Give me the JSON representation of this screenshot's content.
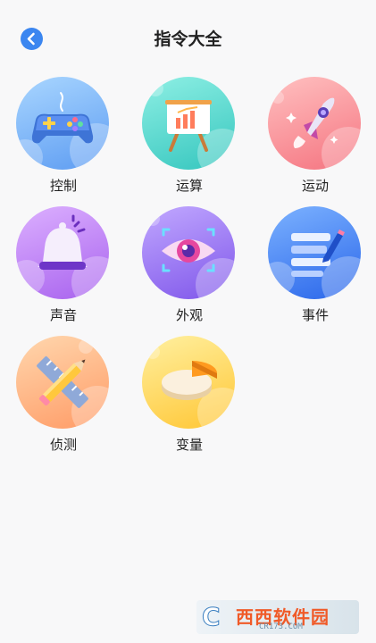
{
  "header": {
    "title": "指令大全"
  },
  "categories": [
    {
      "label": "控制",
      "icon": "gamepad-icon",
      "color_top": "#9fd0ff",
      "color_bottom": "#6aa8f5"
    },
    {
      "label": "运算",
      "icon": "easel-chart-icon",
      "color_top": "#7fe8de",
      "color_bottom": "#3cccc4"
    },
    {
      "label": "运动",
      "icon": "rocket-icon",
      "color_top": "#ffb3b3",
      "color_bottom": "#f97e86"
    },
    {
      "label": "声音",
      "icon": "bell-icon",
      "color_top": "#d8a9ff",
      "color_bottom": "#b06ef2"
    },
    {
      "label": "外观",
      "icon": "eye-icon",
      "color_top": "#b8a0ff",
      "color_bottom": "#8a63ee"
    },
    {
      "label": "事件",
      "icon": "list-pen-icon",
      "color_top": "#6ea8ff",
      "color_bottom": "#2f6fee"
    },
    {
      "label": "侦测",
      "icon": "ruler-pencil-icon",
      "color_top": "#ffd1a6",
      "color_bottom": "#ffa570"
    },
    {
      "label": "变量",
      "icon": "pie-chart-icon",
      "color_top": "#ffe98a",
      "color_bottom": "#ffc93d"
    }
  ],
  "watermark": {
    "logo": "C",
    "main": "西西软件园",
    "sub": "CR173.COM"
  }
}
